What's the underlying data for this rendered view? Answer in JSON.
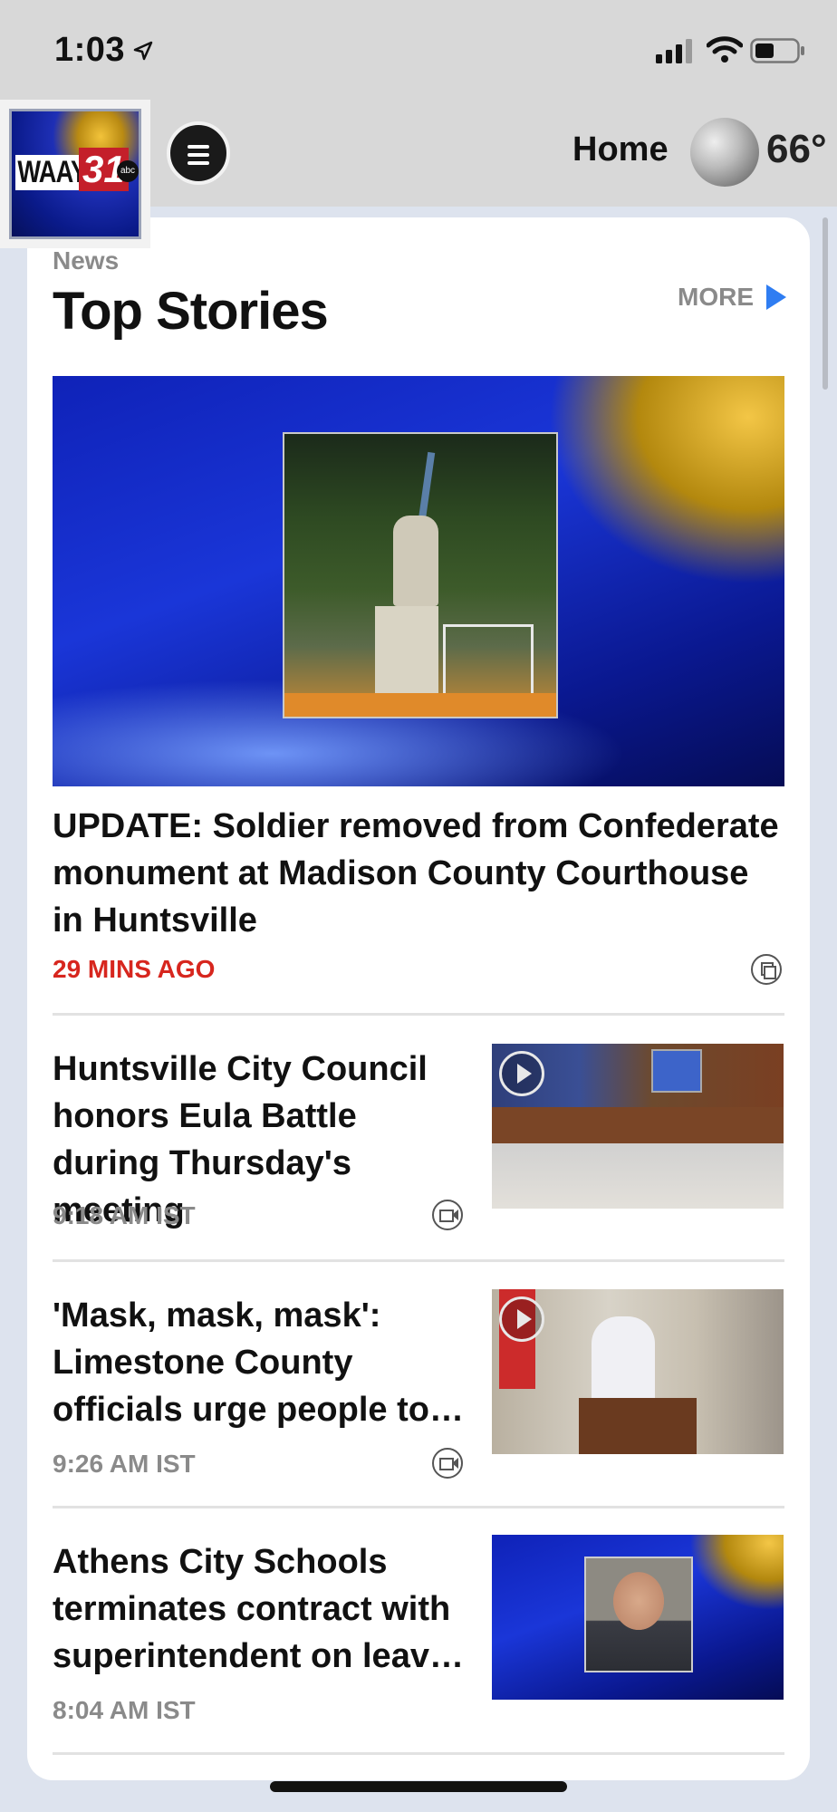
{
  "status_bar": {
    "time": "1:03",
    "icons": [
      "location-arrow-icon",
      "cellular-signal-icon",
      "wifi-icon",
      "battery-icon"
    ]
  },
  "header": {
    "logo": {
      "text": "WAAY",
      "number": "31",
      "network": "abc"
    },
    "menu_icon": "hamburger-menu-icon",
    "nav_label": "Home",
    "weather": {
      "icon": "moon-icon",
      "temperature": "66°"
    }
  },
  "section": {
    "label": "News",
    "title": "Top Stories",
    "more_label": "MORE"
  },
  "hero_story": {
    "headline": "UPDATE: Soldier removed from Confederate monument at Madison County Courthouse in Huntsville",
    "time": "29 MINS AGO",
    "media_icon": "gallery-icon",
    "time_color": "#d7261e"
  },
  "stories": [
    {
      "title": "Huntsville City Council honors Eula Battle during Thursday's meeting",
      "time": "9:18 AM IST",
      "media_icon": "video-icon",
      "has_play": true
    },
    {
      "title": "'Mask, mask, mask': Limestone County officials urge people to…",
      "time": "9:26 AM IST",
      "media_icon": "video-icon",
      "has_play": true
    },
    {
      "title": "Athens City Schools terminates contract with superintendent on leav…",
      "time": "8:04 AM IST",
      "media_icon": null,
      "has_play": false
    }
  ],
  "colors": {
    "accent_blue": "#2f7df2",
    "header_bg": "#d8d8d8",
    "page_bg": "#dde3ee"
  }
}
